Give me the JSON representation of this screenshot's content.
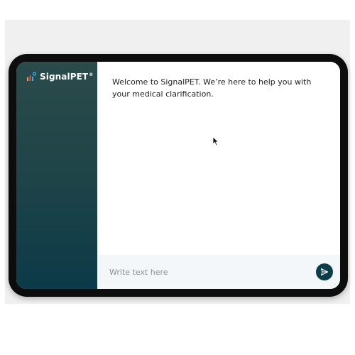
{
  "app": {
    "brand_name": "SignalPET",
    "brand_reg_mark": "®"
  },
  "chat": {
    "welcome_message": "Welcome to SignalPET. We’re here to help you with your medical clarification."
  },
  "composer": {
    "placeholder": "Write text here"
  },
  "colors": {
    "sidebar_top": "#2a4b4a",
    "sidebar_bottom": "#0c3a48",
    "send_button": "#0c3d4a",
    "composer_bg": "#f3f7f9"
  },
  "icons": {
    "logo": "signalpet-logo-icon",
    "send": "send-icon",
    "cursor": "mouse-pointer-icon"
  }
}
